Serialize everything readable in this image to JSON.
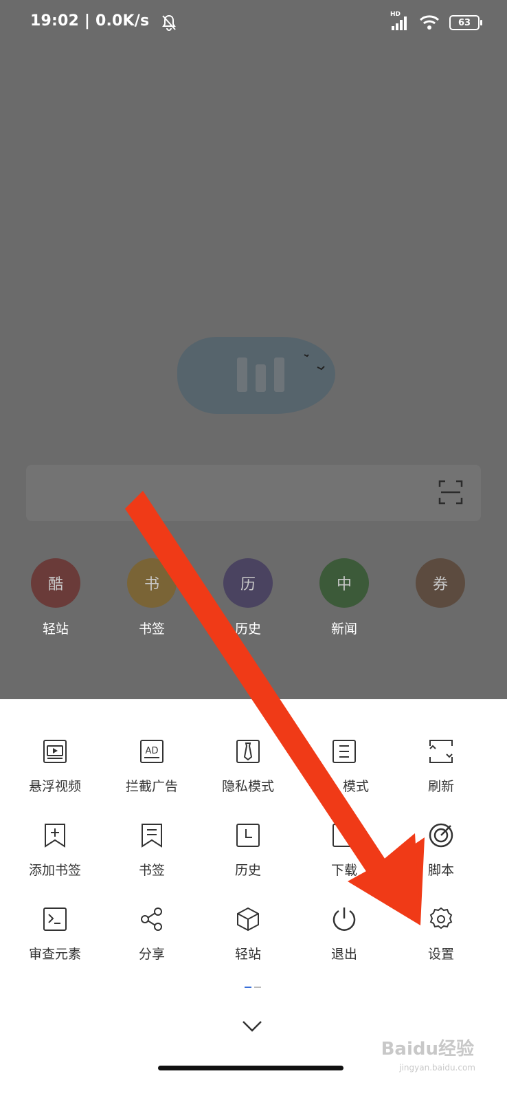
{
  "status_bar": {
    "time": "19:02 | 0.0K/s",
    "battery": "63",
    "network_label": "HD"
  },
  "search": {
    "icon": "scan-icon"
  },
  "quick_links": [
    {
      "label": "轻站",
      "glyph": "酷",
      "color": "#6a3b39"
    },
    {
      "label": "书签",
      "glyph": "书",
      "color": "#7a6436"
    },
    {
      "label": "历史",
      "glyph": "历",
      "color": "#4a4360"
    },
    {
      "label": "新闻",
      "glyph": "中",
      "color": "#3c5a39"
    },
    {
      "label": "",
      "glyph": "券",
      "color": "#5c4b3f"
    }
  ],
  "menu": {
    "items": [
      {
        "label": "悬浮视频",
        "icon": "floating-video-icon"
      },
      {
        "label": "拦截广告",
        "icon": "ad-block-icon"
      },
      {
        "label": "隐私模式",
        "icon": "privacy-mode-icon"
      },
      {
        "label": "模式",
        "icon": "reading-mode-icon"
      },
      {
        "label": "刷新",
        "icon": "refresh-icon"
      },
      {
        "label": "添加书签",
        "icon": "add-bookmark-icon"
      },
      {
        "label": "书签",
        "icon": "bookmark-icon"
      },
      {
        "label": "历史",
        "icon": "history-icon"
      },
      {
        "label": "下载",
        "icon": "download-icon"
      },
      {
        "label": "脚本",
        "icon": "script-icon"
      },
      {
        "label": "审查元素",
        "icon": "inspect-element-icon"
      },
      {
        "label": "分享",
        "icon": "share-icon"
      },
      {
        "label": "轻站",
        "icon": "light-site-icon"
      },
      {
        "label": "退出",
        "icon": "power-icon"
      },
      {
        "label": "设置",
        "icon": "gear-icon"
      }
    ]
  },
  "watermark": {
    "brand": "Baidu经验",
    "url": "jingyan.baidu.com"
  },
  "colors": {
    "annotation_arrow": "#f03a17",
    "active_page_dot": "#3a6fd8"
  }
}
